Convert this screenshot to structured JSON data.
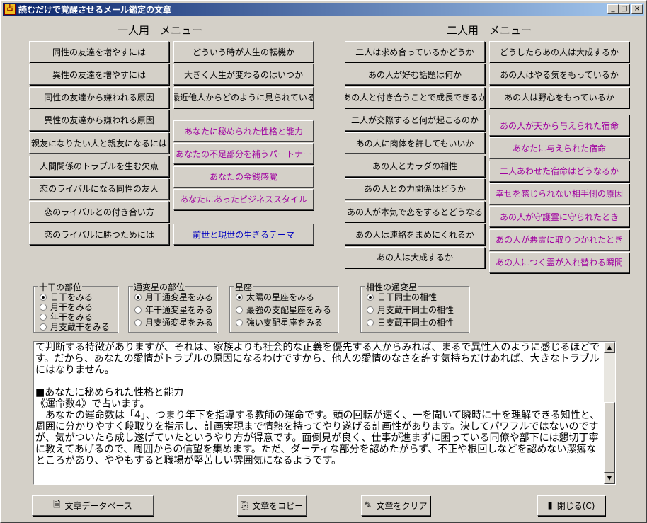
{
  "window": {
    "title": "読むだけで覚醒させるメール鑑定の文章",
    "minimize": "_",
    "maximize": "□",
    "close": "×"
  },
  "single_menu": {
    "header": "一人用　メニュー",
    "col1": [
      "同性の友達を増やすには",
      "異性の友達を増やすには",
      "同性の友達から嫌われる原因",
      "異性の友達から嫌われる原因",
      "親友になりたい人と親友になるには",
      "人間関係のトラブルを生む欠点",
      "恋のライバルになる同性の友人",
      "恋のライバルとの付き合い方",
      "恋のライバルに勝つためには"
    ],
    "col2_top": [
      "どういう時が人生の転機か",
      "大きく人生が変わるのはいつか",
      "最近他人からどのように見られている"
    ],
    "col2_purple": [
      "あなたに秘められた性格と能力",
      "あなたの不足部分を補うパートナー",
      "あなたの金銭感覚",
      "あなたにあったビジネススタイル"
    ],
    "col2_blue": "前世と現世の生きるテーマ"
  },
  "pair_menu": {
    "header": "二人用　メニュー",
    "col1": [
      "二人は求め合っているかどうか",
      "あの人が好む話題は何か",
      "あの人と付き合うことで成長できるか",
      "二人が交際すると何が起こるのか",
      "あの人に肉体を許してもいいか",
      "あの人とカラダの相性",
      "あの人との力関係はどうか",
      "あの人が本気で恋をするとどうなる",
      "あの人は連絡をまめにくれるか",
      "あの人は大成するか"
    ],
    "col2_top": [
      "どうしたらあの人は大成するか",
      "あの人はやる気をもっているか",
      "あの人は野心をもっているか"
    ],
    "col2_purple": [
      "あの人が天から与えられた宿命",
      "あなたに与えられた宿命",
      "二人あわせた宿命はどうなるか",
      "幸せを感じられない相手側の原因",
      "あの人が守護霊に守られたとき",
      "あの人が悪霊に取りつかれたとき",
      "あの人につく霊が入れ替わる瞬間"
    ]
  },
  "options": {
    "jikkan": {
      "label": "十干の部位",
      "items": [
        "日干をみる",
        "月干をみる",
        "年干をみる",
        "月支蔵干をみる"
      ],
      "selected": 0
    },
    "tsuhen": {
      "label": "通変星の部位",
      "items": [
        "月干通変星をみる",
        "年干通変星をみる",
        "月支通変星をみる"
      ],
      "selected": 0
    },
    "seiza": {
      "label": "星座",
      "items": [
        "太陽の星座をみる",
        "最強の支配星座をみる",
        "強い支配星座をみる"
      ],
      "selected": 0
    },
    "aisho": {
      "label": "相性の通変星",
      "items": [
        "日干同士の相性",
        "月支蔵干同士の相性",
        "日支蔵干同士の相性"
      ],
      "selected": 0
    }
  },
  "text_output": "て判断する特徴がありますが、それは、家族よりも社会的な正義を優先する人からみれば、まるで異性人のように感じるほどです。だから、あなたの愛情がトラブルの原因になるわけですから、他人の愛情のなさを許す気持ちだけあれば、大きなトラブルにはなりません。\n\n■あなたに秘められた性格と能力\n《運命数4》で占います。\n　あなたの運命数は「4」、つまり年下を指導する教師の運命です。頭の回転が速く、一を聞いて瞬時に十を理解できる知性と、周囲に分かりやすく段取りを指示し、計画実現まで情熱を持ってやり遂げる計画性があります。決してパワフルではないのですが、気がついたら成し遂げていたというやり方が得意です。面倒見が良く、仕事が進まずに困っている同僚や部下には懇切丁寧に教えてあげるので、周囲からの信望を集めます。ただ、ダーティな部分を認めたがらず、不正や根回しなどを認めない潔癖なところがあり、ややもすると職場が堅苦しい雰囲気になるようです。",
  "bottom_buttons": {
    "database": "文章データベース",
    "copy": "文章をコピー",
    "clear": "文章をクリア",
    "close": "閉じる(C)"
  },
  "icons": [
    "app-icon",
    "database-icon",
    "copy-icon",
    "clear-icon",
    "close-door-icon"
  ]
}
